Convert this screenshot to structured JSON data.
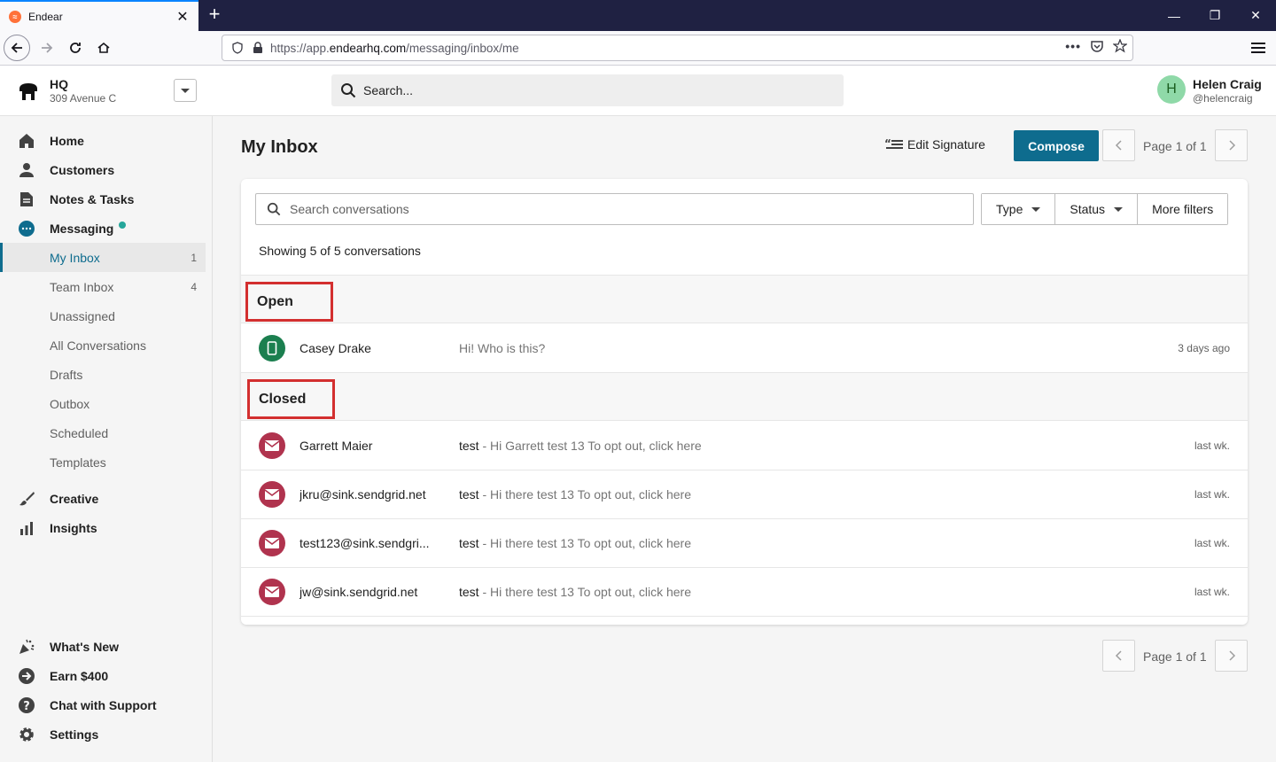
{
  "browser": {
    "tab_title": "Endear",
    "url_prefix": "https://app.",
    "url_domain": "endearhq.com",
    "url_path": "/messaging/inbox/me"
  },
  "store": {
    "name": "HQ",
    "address": "309 Avenue C"
  },
  "global_search": {
    "placeholder": "Search..."
  },
  "user": {
    "initial": "H",
    "name": "Helen Craig",
    "handle": "@helencraig"
  },
  "sidebar": {
    "main_items": [
      {
        "label": "Home",
        "icon": "home-icon"
      },
      {
        "label": "Customers",
        "icon": "person-icon"
      },
      {
        "label": "Notes & Tasks",
        "icon": "document-icon"
      },
      {
        "label": "Messaging",
        "icon": "chat-icon"
      }
    ],
    "messaging_sub": [
      {
        "label": "My Inbox",
        "count": "1"
      },
      {
        "label": "Team Inbox",
        "count": "4"
      },
      {
        "label": "Unassigned",
        "count": ""
      },
      {
        "label": "All Conversations",
        "count": ""
      },
      {
        "label": "Drafts",
        "count": ""
      },
      {
        "label": "Outbox",
        "count": ""
      },
      {
        "label": "Scheduled",
        "count": ""
      },
      {
        "label": "Templates",
        "count": ""
      }
    ],
    "lower_items": [
      {
        "label": "Creative",
        "icon": "brush-icon"
      },
      {
        "label": "Insights",
        "icon": "bar-chart-icon"
      }
    ],
    "footer_items": [
      {
        "label": "What's New",
        "icon": "party-icon"
      },
      {
        "label": "Earn $400",
        "icon": "arrow-circle-icon"
      },
      {
        "label": "Chat with Support",
        "icon": "question-icon"
      },
      {
        "label": "Settings",
        "icon": "gear-icon"
      }
    ]
  },
  "main": {
    "title": "My Inbox",
    "edit_signature": "Edit Signature",
    "compose": "Compose",
    "pager_text": "Page 1 of 1",
    "search_placeholder": "Search conversations",
    "filters": {
      "type": "Type",
      "status": "Status",
      "more": "More filters"
    },
    "showing": "Showing 5 of 5 conversations",
    "sections": {
      "open": {
        "label": "Open",
        "rows": [
          {
            "name": "Casey Drake",
            "subject": "",
            "message": "Hi! Who is this?",
            "time": "3 days ago",
            "channel": "sms"
          }
        ]
      },
      "closed": {
        "label": "Closed",
        "rows": [
          {
            "name": "Garrett Maier",
            "subject": "test",
            "message": " - Hi Garrett test 13 To opt out, click here",
            "time": "last wk.",
            "channel": "email"
          },
          {
            "name": "jkru@sink.sendgrid.net",
            "subject": "test",
            "message": " - Hi there test 13 To opt out, click here",
            "time": "last wk.",
            "channel": "email"
          },
          {
            "name": "test123@sink.sendgri...",
            "subject": "test",
            "message": " - Hi there test 13 To opt out, click here",
            "time": "last wk.",
            "channel": "email"
          },
          {
            "name": "jw@sink.sendgrid.net",
            "subject": "test",
            "message": " - Hi there test 13 To opt out, click here",
            "time": "last wk.",
            "channel": "email"
          }
        ]
      }
    }
  },
  "colors": {
    "brand": "#0e6c8e",
    "sms": "#1b7f4f",
    "email": "#b0334e",
    "highlight": "#d32f2f"
  }
}
